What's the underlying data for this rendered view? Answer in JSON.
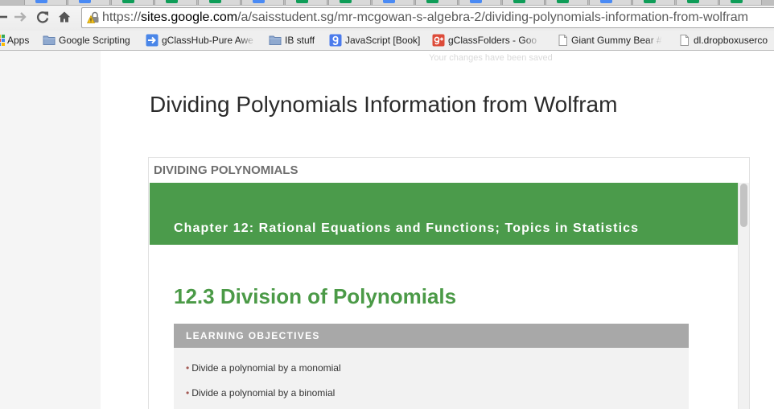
{
  "browser": {
    "tab_strip": {
      "favicon_colors": [
        "#4a8af4",
        "#4a8af4",
        "#0f9d58",
        "#0f9d58",
        "#0f9d58",
        "#4a8af4",
        "#0f9d58",
        "#0f9d58",
        "#4a8af4",
        "#0f9d58",
        "#4a8af4",
        "#0f9d58",
        "#0f9d58",
        "#4a8af4",
        "#0f9d58",
        "#0f9d58",
        "#0f9d58"
      ]
    },
    "nav": {
      "back_icon": "back-arrow-icon",
      "forward_icon": "forward-arrow-icon",
      "reload_icon": "reload-icon",
      "home_icon": "home-icon",
      "forward_enabled": false
    },
    "address_bar": {
      "security_icon": "https-warning-lock-icon",
      "url_scheme": "https://",
      "url_host": "sites.google.com",
      "url_path": "/a/saisstudent.sg/mr-mcgowan-s-algebra-2/dividing-polynomials-information-from-wolfram"
    },
    "bookmarks": [
      {
        "label": "Apps",
        "icon": "apps-grid-icon"
      },
      {
        "label": "Google Scripting",
        "icon": "folder-icon"
      },
      {
        "label": "gClassHub-Pure Awe",
        "icon": "script-arrow-icon"
      },
      {
        "label": "IB stuff",
        "icon": "folder-icon"
      },
      {
        "label": "JavaScript [Book]",
        "icon": "google-icon"
      },
      {
        "label": "gClassFolders - Goo",
        "icon": "google-plus-icon"
      },
      {
        "label": "Giant Gummy Bear #",
        "icon": "page-icon"
      },
      {
        "label": "dl.dropboxuserco",
        "icon": "page-icon"
      }
    ]
  },
  "page": {
    "status_message": "Your changes have been saved",
    "title": "Dividing Polynomials Information from Wolfram",
    "gadget": {
      "title": "DIVIDING POLYNOMIALS",
      "embedded": {
        "chapter_banner": "Chapter 12: Rational Equations and Functions; Topics in Statistics",
        "section_heading": "12.3 Division of Polynomials",
        "objectives": {
          "header": "LEARNING OBJECTIVES",
          "bullet": "•",
          "items": [
            "Divide a polynomial by a monomial",
            "Divide a polynomial by a binomial"
          ]
        }
      }
    }
  },
  "colors": {
    "chapter_banner": "#4b9b4b",
    "section_heading": "#4b9a47",
    "objectives_header": "#a8a8a8",
    "objectives_body": "#f2f2f2",
    "bullet": "#a45a55",
    "url_host": "#000000",
    "url_scheme_path": "#5a5a5a"
  }
}
